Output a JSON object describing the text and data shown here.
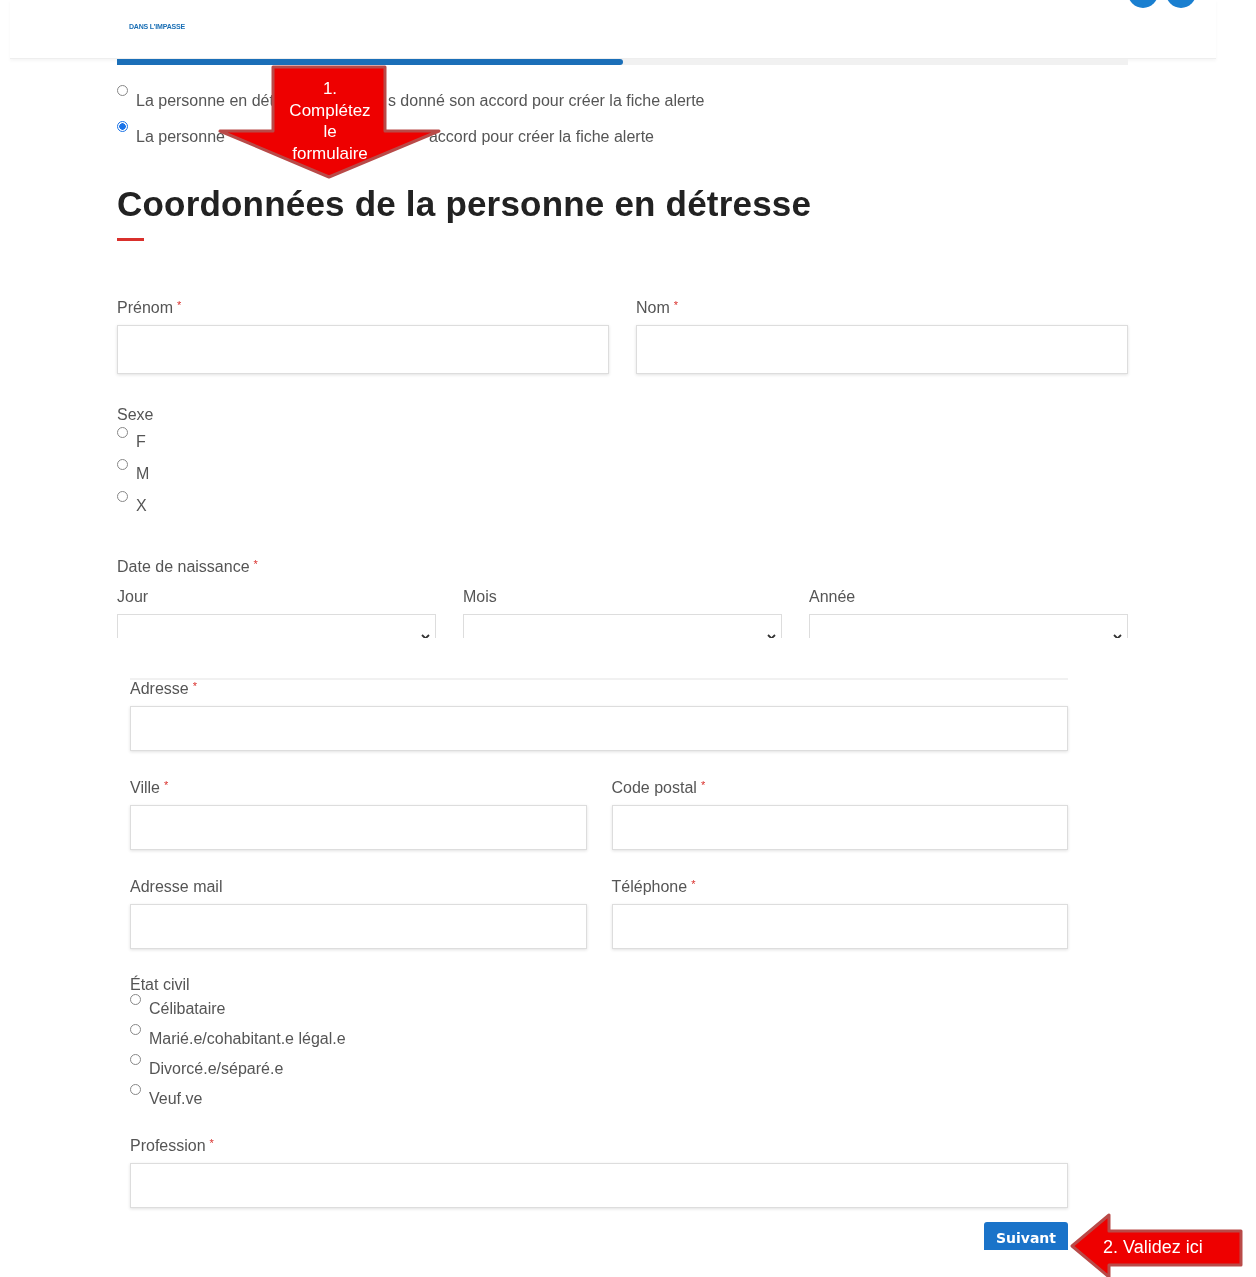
{
  "header": {
    "logo_subtitle": "DANS L'IMPASSE"
  },
  "progress": {
    "level": 0.5
  },
  "consent_options": [
    {
      "parts": [
        "La personne en dét",
        "s donné son accord pour créer la fiche alerte"
      ],
      "selected": false
    },
    {
      "parts": [
        "La personne",
        "accord pour créer la fiche alerte"
      ],
      "selected": true
    }
  ],
  "section_title": "Coordonnées de la personne en détresse",
  "name_fields": [
    {
      "label": "Prénom",
      "required_mark": "*"
    },
    {
      "label": "Nom",
      "required_mark": "*"
    }
  ],
  "sexe": {
    "label": "Sexe",
    "options": [
      {
        "label": "F",
        "selected": false
      },
      {
        "label": "M",
        "selected": false
      },
      {
        "label": "X",
        "selected": false
      }
    ]
  },
  "birth_date": {
    "label": "Date de naissance",
    "required_mark": "*",
    "selects": [
      {
        "label": "Jour"
      },
      {
        "label": "Mois"
      },
      {
        "label": "Année"
      }
    ]
  },
  "contact_rows": [
    [
      {
        "label": "Adresse",
        "required_mark": "*"
      }
    ],
    [
      {
        "label": "Ville",
        "required_mark": "*"
      },
      {
        "label": "Code postal",
        "required_mark": "*"
      }
    ],
    [
      {
        "label": "Adresse mail"
      },
      {
        "label": "Téléphone",
        "required_mark": "*"
      }
    ]
  ],
  "etat_civil": {
    "label": "État civil",
    "options": [
      {
        "label": "Célibataire",
        "selected": false
      },
      {
        "label": "Marié.e/cohabitant.e légal.e",
        "selected": false
      },
      {
        "label": "Divorcé.e/séparé.e",
        "selected": false
      },
      {
        "label": "Veuf.ve",
        "selected": false
      }
    ]
  },
  "profession": {
    "label": "Profession",
    "required_mark": "*"
  },
  "submit_button": "Suivant",
  "callouts": [
    {
      "kind": "down-arrow",
      "text": "1.\nComplétez\nle\nformulaire"
    },
    {
      "kind": "left-arrow",
      "text": "2. Validez ici"
    }
  ]
}
